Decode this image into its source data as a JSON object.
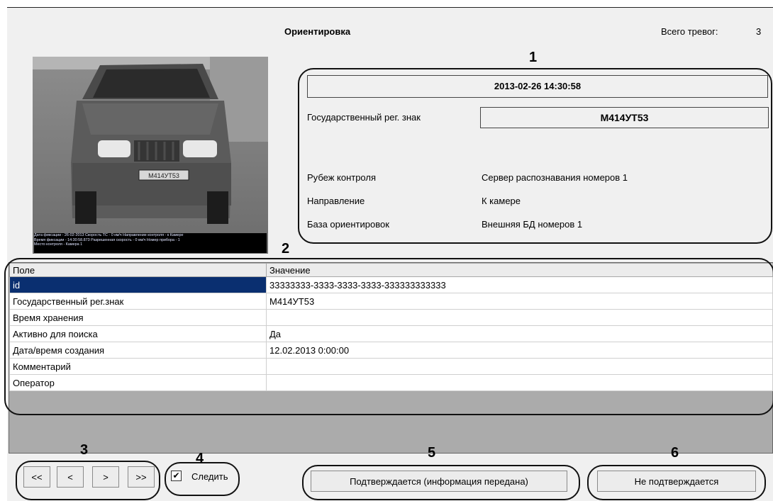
{
  "header": {
    "title": "Ориентировка",
    "total_label": "Всего тревог:",
    "total_value": "3"
  },
  "photo": {
    "caption_lines": [
      "Дата фиксации - 26-02-2013  Скорость ТС - 0 км/ч  Направление контроля - к Камере",
      "Время фиксации - 14:30:58.873   Разрешенная скорость - 0 км/ч      Номер прибора - 1",
      "Место контроля - Камера 1"
    ],
    "plate_text": "М414УТ53"
  },
  "event": {
    "datetime": "2013-02-26 14:30:58",
    "plate_label": "Государственный рег. знак",
    "plate_value": "М414УТ53",
    "rows": [
      {
        "label": "Рубеж контроля",
        "value": "Сервер распознавания номеров 1"
      },
      {
        "label": "Направление",
        "value": "К камере"
      },
      {
        "label": "База ориентировок",
        "value": "Внешняя БД номеров 1"
      }
    ]
  },
  "table": {
    "col_field": "Поле",
    "col_value": "Значение",
    "rows": [
      {
        "field": "id",
        "value": "33333333-3333-3333-3333-333333333333"
      },
      {
        "field": "Государственный рег.знак",
        "value": "М414УТ53"
      },
      {
        "field": "Время хранения",
        "value": ""
      },
      {
        "field": "Активно для поиска",
        "value": "Да"
      },
      {
        "field": "Дата/время создания",
        "value": "12.02.2013 0:00:00"
      },
      {
        "field": "Комментарий",
        "value": ""
      },
      {
        "field": "Оператор",
        "value": ""
      }
    ]
  },
  "nav": {
    "first": "<<",
    "prev": "<",
    "next": ">",
    "last": ">>"
  },
  "follow": {
    "label": "Следить",
    "checked": true
  },
  "actions": {
    "confirm": "Подтверждается (информация передана)",
    "reject": "Не подтверждается"
  },
  "callouts": [
    "1",
    "2",
    "3",
    "4",
    "5",
    "6"
  ]
}
